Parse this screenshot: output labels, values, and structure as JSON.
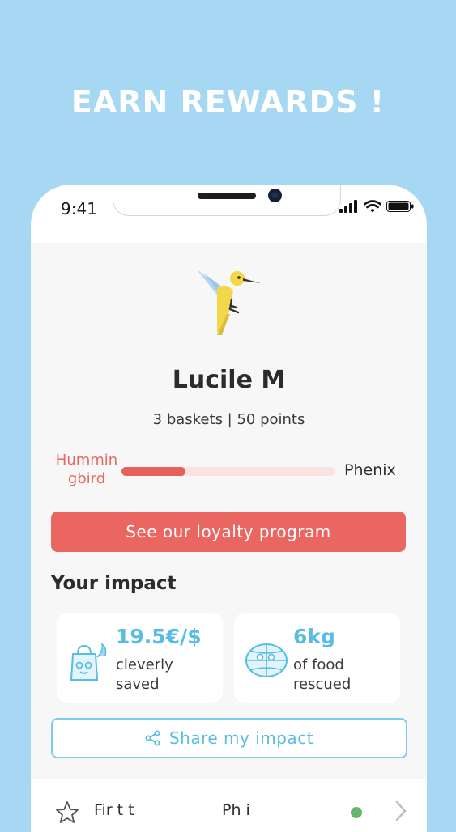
{
  "headline": "EARN REWARDS !",
  "status_bar": {
    "time": "9:41"
  },
  "profile": {
    "name": "Lucile M",
    "stats": "3 baskets | 50 points",
    "level_current_line1": "Hummin",
    "level_current_line2": "gbird",
    "level_next": "Phenix",
    "progress": 0.3
  },
  "loyalty_button": "See our loyalty program",
  "impact": {
    "title": "Your impact",
    "cards": [
      {
        "value": "19.5€/$",
        "label_line1": "cleverly",
        "label_line2": "saved",
        "icon": "shopping-bag-icon"
      },
      {
        "value": "6kg",
        "label_line1": "of food",
        "label_line2": "rescued",
        "icon": "globe-icon"
      }
    ]
  },
  "share_button": "Share my impact",
  "bottom_row": {
    "label1": "Fir t t",
    "label2": "Ph i",
    "icon": "star-icon"
  },
  "colors": {
    "background": "#a6d8f3",
    "accent_red": "#ea6660",
    "accent_blue": "#57bde3",
    "progress_fill": "#e7615c"
  }
}
